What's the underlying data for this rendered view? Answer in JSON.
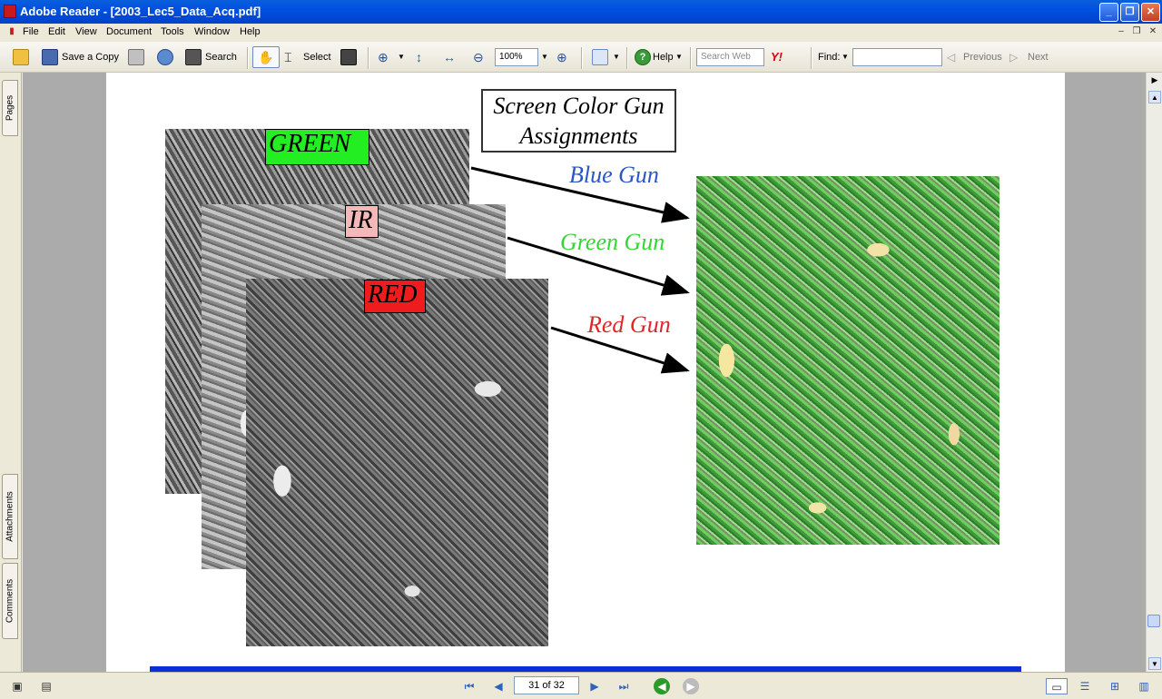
{
  "window": {
    "title": "Adobe Reader - [2003_Lec5_Data_Acq.pdf]"
  },
  "menu": [
    "File",
    "Edit",
    "View",
    "Document",
    "Tools",
    "Window",
    "Help"
  ],
  "toolbar": {
    "save_copy": "Save a Copy",
    "search": "Search",
    "select": "Select",
    "zoom": "100%",
    "help": "Help",
    "search_web_placeholder": "Search Web",
    "find_label": "Find:",
    "previous": "Previous",
    "next": "Next"
  },
  "left_tabs": {
    "pages": "Pages",
    "attachments": "Attachments",
    "comments": "Comments"
  },
  "slide": {
    "title_line1": "Screen Color Gun",
    "title_line2": "Assignments",
    "band_green": "GREEN",
    "band_ir": "IR",
    "band_red": "RED",
    "gun_blue": "Blue Gun",
    "gun_green": "Green Gun",
    "gun_red": "Red Gun",
    "colors": {
      "blue_gun": "#2a55c8",
      "green_gun": "#33d633",
      "red_gun": "#e0262a",
      "green_band": "#22ee22",
      "ir_band": "#f4b8b8",
      "red_band": "#ee1c1c",
      "footer_bar": "#0b2ed6"
    }
  },
  "status": {
    "page_indicator": "31 of 32"
  }
}
